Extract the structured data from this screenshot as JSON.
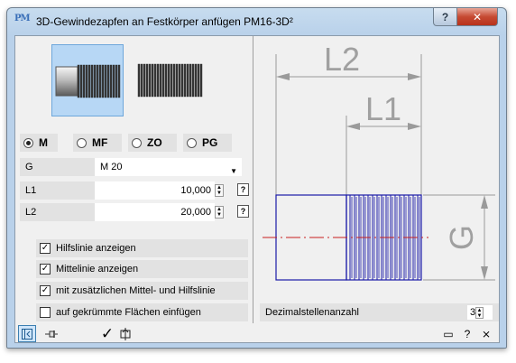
{
  "window": {
    "title": "3D-Gewindezapfen an Festkörper anfügen  PM16-3D²",
    "help_button": "?",
    "close_button": "✕",
    "app_icon_text": "PM"
  },
  "thread_types": [
    {
      "label": "M",
      "selected": true
    },
    {
      "label": "MF",
      "selected": false
    },
    {
      "label": "ZO",
      "selected": false
    },
    {
      "label": "PG",
      "selected": false
    }
  ],
  "properties": {
    "g": {
      "label": "G",
      "value": "M 20"
    },
    "l1": {
      "label": "L1",
      "value": "10,000"
    },
    "l2": {
      "label": "L2",
      "value": "20,000"
    },
    "help_glyph": "?"
  },
  "options": [
    {
      "label": "Hilfslinie anzeigen",
      "checked": true
    },
    {
      "label": "Mittelinie anzeigen",
      "checked": true
    },
    {
      "label": "mit zusätzlichen Mittel- und Hilfslinie",
      "checked": true
    },
    {
      "label": "auf gekrümmte Flächen einfügen",
      "checked": false
    }
  ],
  "drawing": {
    "dim_l2": "L2",
    "dim_l1": "L1",
    "dim_g": "G"
  },
  "decimals": {
    "label": "Dezimalstellenanzahl",
    "value": "3"
  },
  "bottom": {
    "window_controls": [
      "▭",
      "?",
      "⨯"
    ]
  },
  "colors": {
    "accent": "#2f6fd6",
    "part_outline": "#1a1aa8",
    "centerline": "#c81e1e",
    "dimension": "#9a9a9a"
  }
}
